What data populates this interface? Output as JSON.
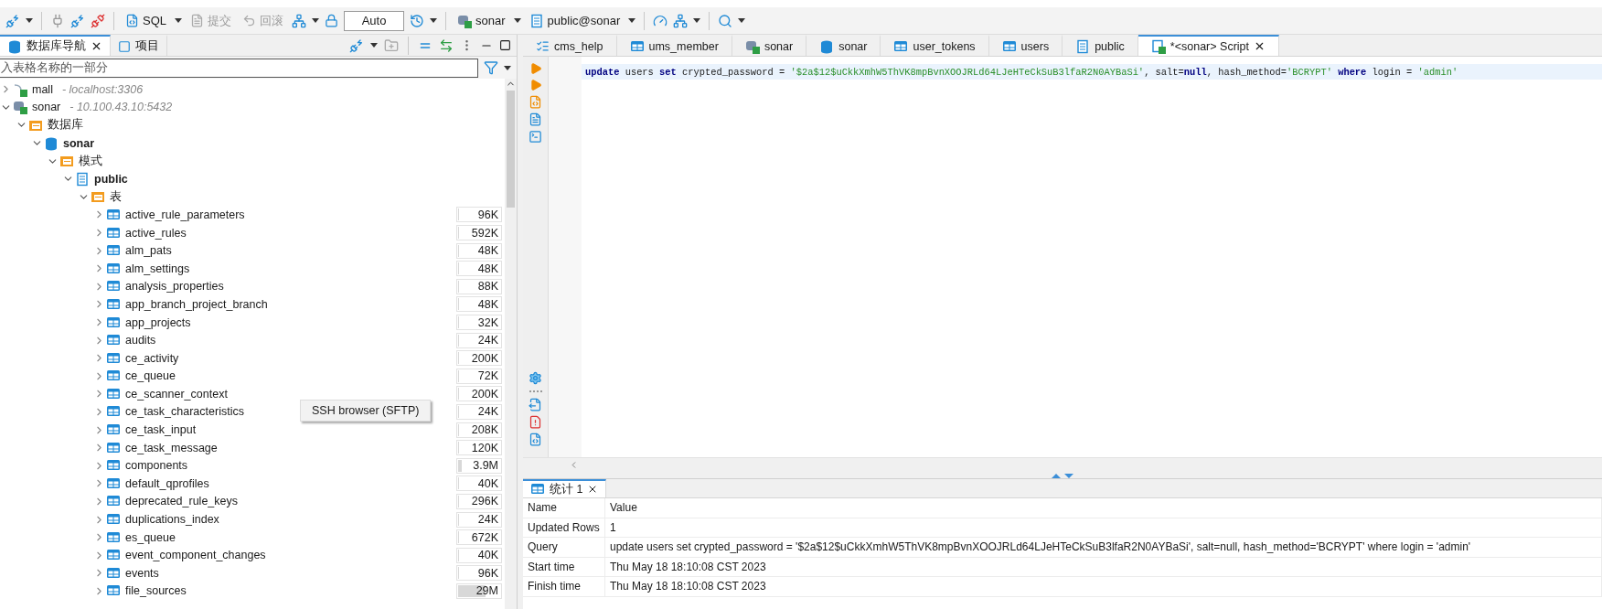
{
  "toolbar": {
    "sql": "SQL",
    "commit": {
      "label": "提交",
      "disabled": true
    },
    "rollback": {
      "label": "回滚",
      "disabled": true
    },
    "transaction_mode": "Auto",
    "datasource": "sonar",
    "schema": "public@sonar"
  },
  "navigator": {
    "tabs": [
      {
        "label": "数据库导航",
        "selected": true,
        "closable": true
      },
      {
        "label": "项目",
        "selected": false,
        "closable": false
      }
    ],
    "filter": {
      "placeholder": "入表格名称的一部分"
    },
    "tree": [
      {
        "label": "mall",
        "detail": "- localhost:3306",
        "kind": "mysql-connection",
        "expanded": false
      },
      {
        "label": "sonar",
        "detail": "- 10.100.43.10:5432",
        "kind": "postgres-connection",
        "expanded": true,
        "children": [
          {
            "label": "数据库",
            "kind": "databases",
            "expanded": true,
            "children": [
              {
                "label": "sonar",
                "kind": "database",
                "expanded": true,
                "children": [
                  {
                    "label": "模式",
                    "kind": "schemas",
                    "expanded": true,
                    "children": [
                      {
                        "label": "public",
                        "kind": "schema",
                        "expanded": true,
                        "children": [
                          {
                            "label": "表",
                            "kind": "tables",
                            "expanded": true,
                            "children": [
                              {
                                "label": "active_rule_parameters",
                                "kind": "table",
                                "expanded": false,
                                "size": "96K",
                                "level": 0.01
                              },
                              {
                                "label": "active_rules",
                                "kind": "table",
                                "expanded": false,
                                "size": "592K",
                                "level": 0.02
                              },
                              {
                                "label": "alm_pats",
                                "kind": "table",
                                "expanded": false,
                                "size": "48K",
                                "level": 0.01
                              },
                              {
                                "label": "alm_settings",
                                "kind": "table",
                                "expanded": false,
                                "size": "48K",
                                "level": 0.01
                              },
                              {
                                "label": "analysis_properties",
                                "kind": "table",
                                "expanded": false,
                                "size": "88K",
                                "level": 0.01
                              },
                              {
                                "label": "app_branch_project_branch",
                                "kind": "table",
                                "expanded": false,
                                "size": "48K",
                                "level": 0.01
                              },
                              {
                                "label": "app_projects",
                                "kind": "table",
                                "expanded": false,
                                "size": "32K",
                                "level": 0.01
                              },
                              {
                                "label": "audits",
                                "kind": "table",
                                "expanded": false,
                                "size": "24K",
                                "level": 0.01
                              },
                              {
                                "label": "ce_activity",
                                "kind": "table",
                                "expanded": false,
                                "size": "200K",
                                "level": 0.02
                              },
                              {
                                "label": "ce_queue",
                                "kind": "table",
                                "expanded": false,
                                "size": "72K",
                                "level": 0.01
                              },
                              {
                                "label": "ce_scanner_context",
                                "kind": "table",
                                "expanded": false,
                                "size": "200K",
                                "level": 0.02
                              },
                              {
                                "label": "ce_task_characteristics",
                                "kind": "table",
                                "expanded": false,
                                "size": "24K",
                                "level": 0.01
                              },
                              {
                                "label": "ce_task_input",
                                "kind": "table",
                                "expanded": false,
                                "size": "208K",
                                "level": 0.02
                              },
                              {
                                "label": "ce_task_message",
                                "kind": "table",
                                "expanded": false,
                                "size": "120K",
                                "level": 0.02
                              },
                              {
                                "label": "components",
                                "kind": "table",
                                "expanded": false,
                                "size": "3.9M",
                                "level": 0.08
                              },
                              {
                                "label": "default_qprofiles",
                                "kind": "table",
                                "expanded": false,
                                "size": "40K",
                                "level": 0.01
                              },
                              {
                                "label": "deprecated_rule_keys",
                                "kind": "table",
                                "expanded": false,
                                "size": "296K",
                                "level": 0.02
                              },
                              {
                                "label": "duplications_index",
                                "kind": "table",
                                "expanded": false,
                                "size": "24K",
                                "level": 0.01
                              },
                              {
                                "label": "es_queue",
                                "kind": "table",
                                "expanded": false,
                                "size": "672K",
                                "level": 0.02
                              },
                              {
                                "label": "event_component_changes",
                                "kind": "table",
                                "expanded": false,
                                "size": "40K",
                                "level": 0.01
                              },
                              {
                                "label": "events",
                                "kind": "table",
                                "expanded": false,
                                "size": "96K",
                                "level": 0.01
                              },
                              {
                                "label": "file_sources",
                                "kind": "table",
                                "expanded": false,
                                "size": "29M",
                                "level": 0.62
                              }
                            ]
                          }
                        ]
                      }
                    ]
                  }
                ]
              }
            ]
          }
        ]
      }
    ]
  },
  "tooltip": "SSH browser (SFTP)",
  "editor_tabs": [
    {
      "label": "cms_help",
      "kind": "sql",
      "selected": false,
      "closable": false
    },
    {
      "label": "ums_member",
      "kind": "table",
      "selected": false,
      "closable": false
    },
    {
      "label": "sonar",
      "kind": "connection",
      "selected": false,
      "closable": false
    },
    {
      "label": "sonar",
      "kind": "database",
      "selected": false,
      "closable": false
    },
    {
      "label": "user_tokens",
      "kind": "table",
      "selected": false,
      "closable": false
    },
    {
      "label": "users",
      "kind": "table",
      "selected": false,
      "closable": false
    },
    {
      "label": "public",
      "kind": "schema",
      "selected": false,
      "closable": false
    },
    {
      "label": "*<sonar> Script",
      "kind": "script",
      "selected": true,
      "closable": true
    }
  ],
  "code_line": [
    {
      "kind": "keyword",
      "text": "update"
    },
    {
      "kind": "plain",
      "text": " users "
    },
    {
      "kind": "keyword",
      "text": "set"
    },
    {
      "kind": "plain",
      "text": " crypted_password = "
    },
    {
      "kind": "string",
      "text": "'$2a$12$uCkkXmhW5ThVK8mpBvnXOOJRLd64LJeHTeCkSuB3lfaR2N0AYBaSi'"
    },
    {
      "kind": "plain",
      "text": ", salt="
    },
    {
      "kind": "keyword",
      "text": "null"
    },
    {
      "kind": "plain",
      "text": ", hash_method="
    },
    {
      "kind": "string",
      "text": "'BCRYPT' "
    },
    {
      "kind": "keyword",
      "text": "where"
    },
    {
      "kind": "plain",
      "text": " login = "
    },
    {
      "kind": "string",
      "text": "'admin'"
    }
  ],
  "results": {
    "tabs": [
      {
        "label": "统计 1",
        "selected": true,
        "closable": true
      }
    ],
    "columns": [
      "Name",
      "Value"
    ],
    "rows": [
      [
        "Updated Rows",
        "1"
      ],
      [
        "Query",
        "update users set crypted_password = '$2a$12$uCkkXmhW5ThVK8mpBvnXOOJRLd64LJeHTeCkSuB3lfaR2N0AYBaSi', salt=null, hash_method='BCRYPT' where login = 'admin'"
      ],
      [
        "Start time",
        "Thu May 18 18:10:08 CST 2023"
      ],
      [
        "Finish time",
        "Thu May 18 18:10:08 CST 2023"
      ]
    ]
  }
}
